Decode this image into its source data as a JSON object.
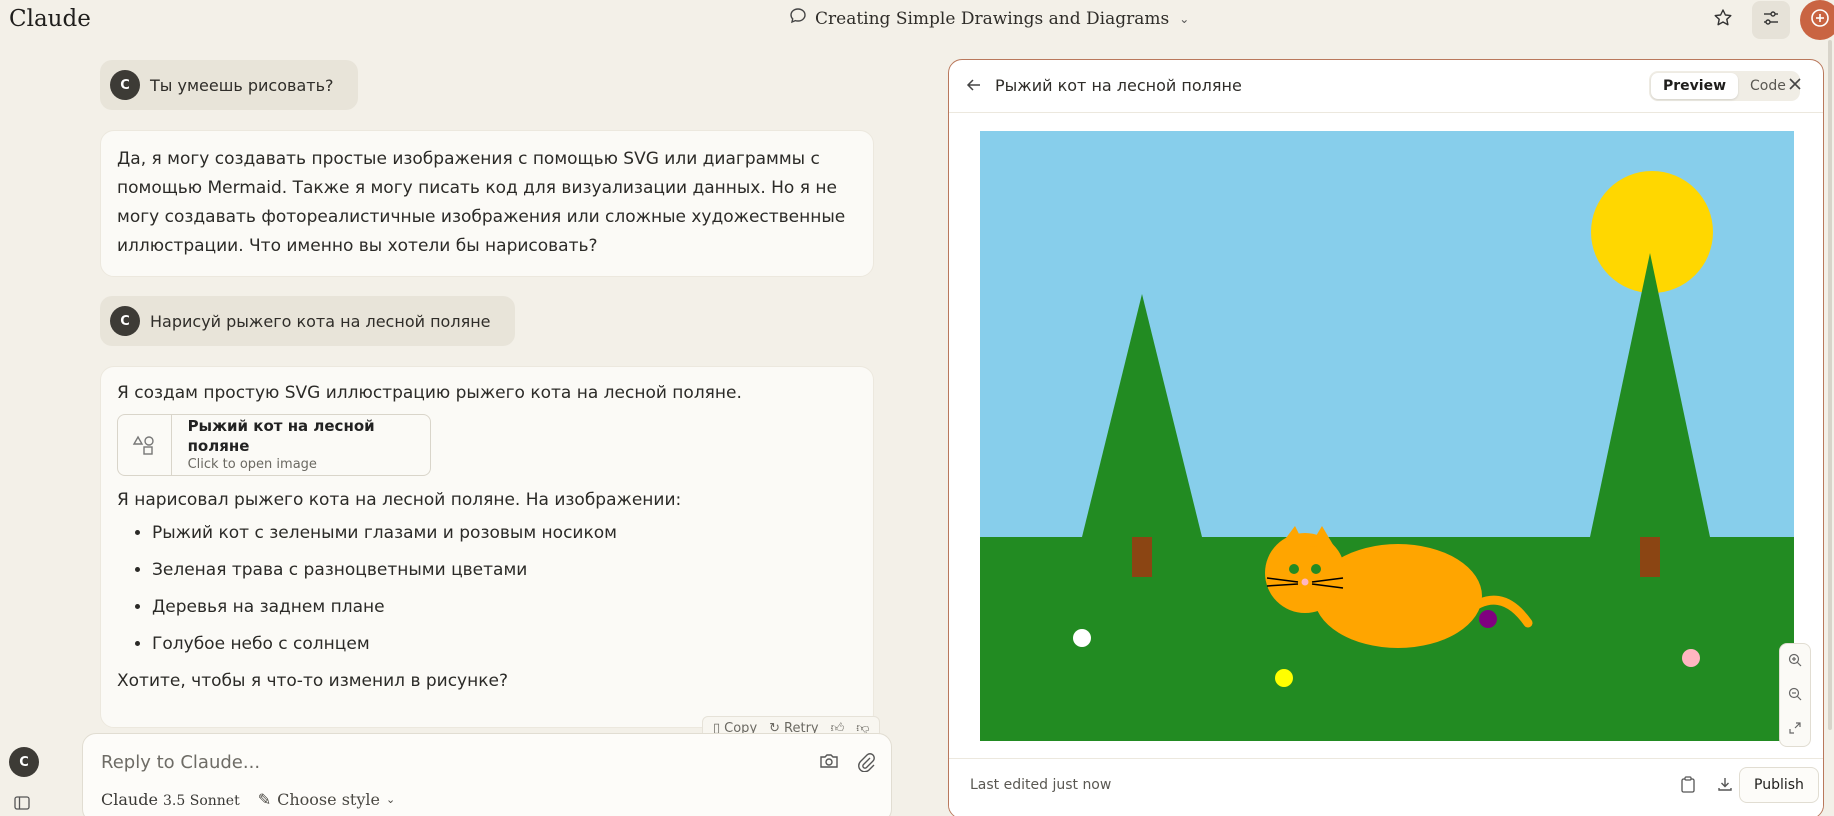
{
  "app": {
    "name": "Claude"
  },
  "header": {
    "conversation_title": "Creating Simple Drawings and Diagrams"
  },
  "messages": {
    "user1": {
      "avatar": "C",
      "text": "Ты умеешь рисовать?"
    },
    "ai1": {
      "text": "Да, я могу создавать простые изображения с помощью SVG или диаграммы с помощью Mermaid. Также я могу писать код для визуализации данных. Но я не могу создавать фотореалистичные изображения или сложные художественные иллюстрации. Что именно вы хотели бы нарисовать?"
    },
    "user2": {
      "avatar": "C",
      "text": "Нарисуй рыжего кота на лесной поляне"
    },
    "ai2": {
      "intro": "Я создам простую SVG иллюстрацию рыжего кота на лесной поляне.",
      "artifact_title": "Рыжий кот на лесной поляне",
      "artifact_sub": "Click to open image",
      "after": "Я нарисовал рыжего кота на лесной поляне. На изображении:",
      "bullets": [
        "Рыжий кот с зелеными глазами и розовым носиком",
        "Зеленая трава с разноцветными цветами",
        "Деревья на заднем плане",
        "Голубое небо с солнцем"
      ],
      "outro": "Хотите, чтобы я что-то изменил в рисунке?"
    }
  },
  "message_actions": {
    "copy": "Copy",
    "retry": "Retry"
  },
  "composer": {
    "placeholder": "Reply to Claude...",
    "model_name": "Claude",
    "model_version": "3.5 Sonnet",
    "style_label": "Choose style"
  },
  "user": {
    "initial": "C"
  },
  "artifact_panel": {
    "title": "Рыжий кот на лесной поляне",
    "tab_preview": "Preview",
    "tab_code": "Code",
    "last_edited": "Last edited just now",
    "publish": "Publish"
  },
  "colors": {
    "accent": "#c96442",
    "sky": "#87ceeb",
    "grass": "#228b22",
    "sun": "#ffd700",
    "cat": "#ffa500",
    "trunk": "#8b4513"
  }
}
